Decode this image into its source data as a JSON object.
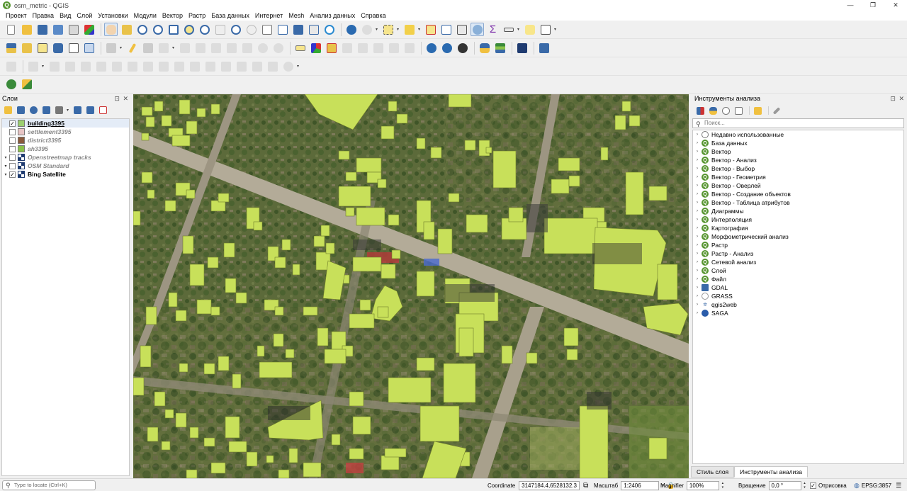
{
  "window": {
    "title": "osm_metric - QGIS",
    "app_icon": "Q",
    "buttons": [
      "—",
      "❐",
      "✕"
    ]
  },
  "menu": [
    "Проект",
    "Правка",
    "Вид",
    "Слой",
    "Установки",
    "Модули",
    "Вектор",
    "Растр",
    "База данных",
    "Интернет",
    "Mesh",
    "Анализ данных",
    "Справка"
  ],
  "layers_panel": {
    "title": "Слои",
    "buttons": "⊡ ✕",
    "layers": [
      {
        "name": "building3395",
        "checked": true,
        "expander": "",
        "icon": "swatch",
        "color": "#9ccf70",
        "style": "active"
      },
      {
        "name": "settlement3395",
        "checked": false,
        "expander": "",
        "icon": "swatch",
        "color": "#e8c5c5",
        "style": "off"
      },
      {
        "name": "district3395",
        "checked": false,
        "expander": "",
        "icon": "swatch",
        "color": "#8b5a3c",
        "style": "off"
      },
      {
        "name": "ah3395",
        "checked": false,
        "expander": "",
        "icon": "swatch",
        "color": "#8bc34a",
        "style": "off"
      },
      {
        "name": "Openstreetmap tracks",
        "checked": false,
        "expander": "▾",
        "icon": "grid",
        "color": "",
        "style": "off"
      },
      {
        "name": "OSM Standard",
        "checked": false,
        "expander": "▾",
        "icon": "grid",
        "color": "",
        "style": "off"
      },
      {
        "name": "Bing Satellite",
        "checked": true,
        "expander": "▾",
        "icon": "grid",
        "color": "",
        "style": "visible"
      }
    ]
  },
  "processing_panel": {
    "title": "Инструменты анализа",
    "buttons": "⊡ ✕",
    "search_placeholder": "Поиск...",
    "items": [
      {
        "label": "Недавно использованные",
        "icon": "clock-icon",
        "glyph": ""
      },
      {
        "label": "База данных",
        "icon": "qgis-icon",
        "glyph": "Q"
      },
      {
        "label": "Вектор",
        "icon": "qgis-icon",
        "glyph": "Q"
      },
      {
        "label": "Вектор - Анализ",
        "icon": "qgis-icon",
        "glyph": "Q"
      },
      {
        "label": "Вектор - Выбор",
        "icon": "qgis-icon",
        "glyph": "Q"
      },
      {
        "label": "Вектор - Геометрия",
        "icon": "qgis-icon",
        "glyph": "Q"
      },
      {
        "label": "Вектор - Оверлей",
        "icon": "qgis-icon",
        "glyph": "Q"
      },
      {
        "label": "Вектор - Создание объектов",
        "icon": "qgis-icon",
        "glyph": "Q"
      },
      {
        "label": "Вектор - Таблица атрибутов",
        "icon": "qgis-icon",
        "glyph": "Q"
      },
      {
        "label": "Диаграммы",
        "icon": "qgis-icon",
        "glyph": "Q"
      },
      {
        "label": "Интерполяция",
        "icon": "qgis-icon",
        "glyph": "Q"
      },
      {
        "label": "Картография",
        "icon": "qgis-icon",
        "glyph": "Q"
      },
      {
        "label": "Морфометрический анализ",
        "icon": "qgis-icon",
        "glyph": "Q"
      },
      {
        "label": "Растр",
        "icon": "qgis-icon",
        "glyph": "Q"
      },
      {
        "label": "Растр - Анализ",
        "icon": "qgis-icon",
        "glyph": "Q"
      },
      {
        "label": "Сетевой анализ",
        "icon": "qgis-icon",
        "glyph": "Q"
      },
      {
        "label": "Слой",
        "icon": "qgis-icon",
        "glyph": "Q"
      },
      {
        "label": "Файл",
        "icon": "qgis-icon",
        "glyph": "Q"
      },
      {
        "label": "GDAL",
        "icon": "gdal-icon",
        "glyph": ""
      },
      {
        "label": "GRASS",
        "icon": "grass-icon",
        "glyph": ""
      },
      {
        "label": "qgis2web",
        "icon": "qgis2web-icon",
        "glyph": "✲"
      },
      {
        "label": "SAGA",
        "icon": "saga-icon",
        "glyph": ""
      }
    ],
    "tabs": [
      "Стиль слоя",
      "Инструменты анализа"
    ]
  },
  "statusbar": {
    "locator_placeholder": "Type to locate (Ctrl+K)",
    "coordinate_label": "Coordinate",
    "coordinate_value": "3147184.4,6528132.3",
    "scale_label": "Масштаб",
    "scale_value": "1:2406",
    "magnifier_label": "Magnifier",
    "magnifier_value": "100%",
    "rotation_label": "Вращение",
    "rotation_value": "0,0 °",
    "render_label": "Отрисовка",
    "render_checked": true,
    "crs": "EPSG:3857"
  },
  "colors": {
    "building_fill": "#c8e05a",
    "road": "#b3ab98",
    "panel_bg": "#f0f0f0"
  }
}
